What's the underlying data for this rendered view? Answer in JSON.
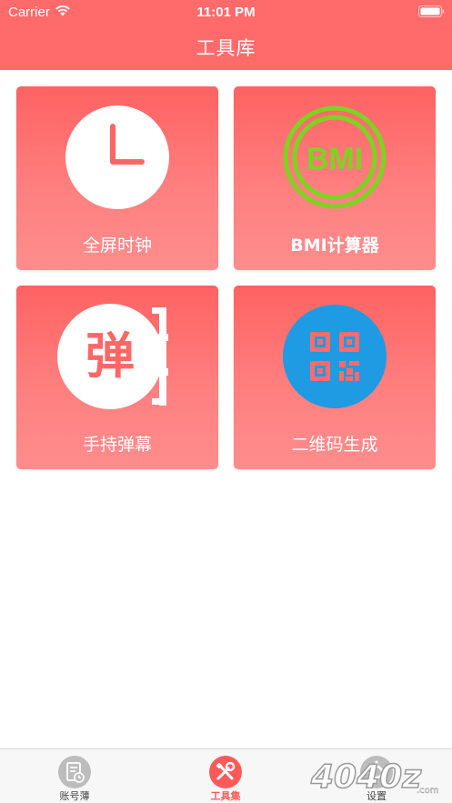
{
  "status_bar": {
    "carrier": "Carrier",
    "time": "11:01 PM"
  },
  "nav": {
    "title": "工具库"
  },
  "tools": [
    {
      "label": "全屏时钟",
      "icon": "clock-icon"
    },
    {
      "label": "BMI计算器",
      "icon": "bmi-icon",
      "icon_text": "BMI"
    },
    {
      "label": "手持弹幕",
      "icon": "danmu-icon",
      "icon_text": "弹"
    },
    {
      "label": "二维码生成",
      "icon": "qr-code-icon"
    }
  ],
  "tabbar": {
    "items": [
      {
        "label": "账号薄",
        "icon": "ledger-icon",
        "active": false
      },
      {
        "label": "工具集",
        "icon": "tools-icon",
        "active": true
      },
      {
        "label": "设置",
        "icon": "settings-icon",
        "active": false
      }
    ]
  },
  "watermark": {
    "text": "4040z",
    "suffix": ".com"
  },
  "colors": {
    "accent": "#ff6b6b",
    "card_top": "#ff6262",
    "card_bottom": "#ff8d8d",
    "bmi_green": "#7ed321",
    "qr_blue": "#1e9be2",
    "tab_active": "#ff5a5a",
    "tab_inactive": "#bdbdbd"
  }
}
